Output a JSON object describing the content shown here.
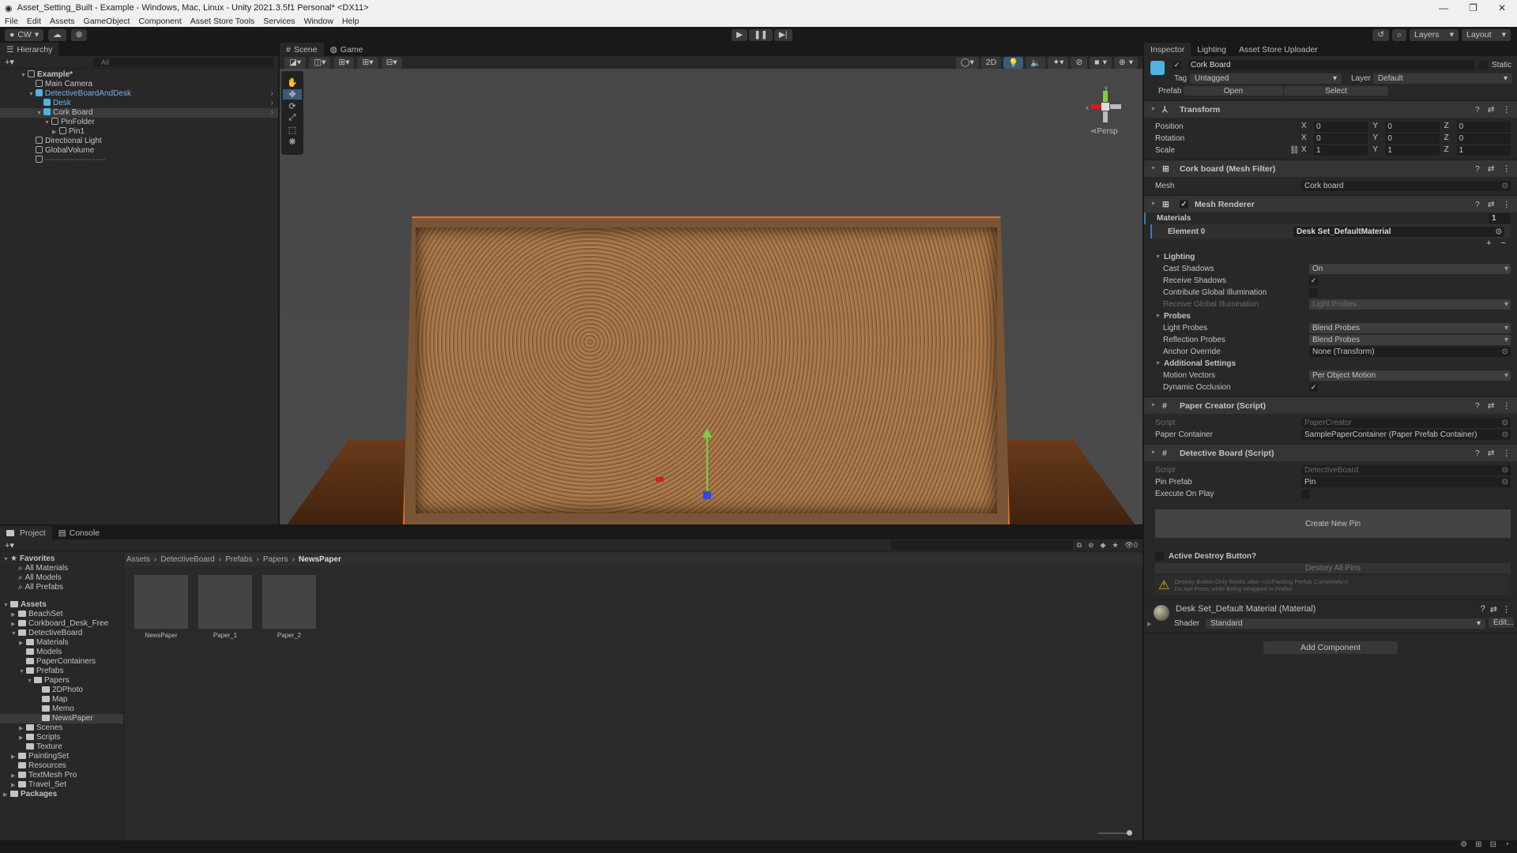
{
  "window": {
    "title": "Asset_Setting_Built - Example - Windows, Mac, Linux - Unity 2021.3.5f1 Personal* <DX11>",
    "controls": [
      "—",
      "❐",
      "✕"
    ]
  },
  "menu": [
    "File",
    "Edit",
    "Assets",
    "GameObject",
    "Component",
    "Asset Store Tools",
    "Services",
    "Window",
    "Help"
  ],
  "toolbar": {
    "account": "CW",
    "layers": "Layers",
    "layout": "Layout"
  },
  "hierarchy": {
    "tab": "Hierarchy",
    "search_placeholder": "All",
    "items": [
      {
        "label": "Example*",
        "depth": 0,
        "type": "scene",
        "expanded": true
      },
      {
        "label": "Main Camera",
        "depth": 1,
        "type": "obj"
      },
      {
        "label": "DetectiveBoardAndDesk",
        "depth": 1,
        "type": "prefab",
        "expanded": true,
        "blue": true
      },
      {
        "label": "Desk",
        "depth": 2,
        "type": "prefab",
        "blue": true
      },
      {
        "label": "Cork Board",
        "depth": 2,
        "type": "prefab",
        "expanded": true,
        "selected": true
      },
      {
        "label": "PinFolder",
        "depth": 3,
        "type": "obj",
        "expanded": true
      },
      {
        "label": "Pin1",
        "depth": 4,
        "type": "obj",
        "collapsed": true
      },
      {
        "label": "Directional Light",
        "depth": 1,
        "type": "obj"
      },
      {
        "label": "GlobalVolume",
        "depth": 1,
        "type": "obj"
      },
      {
        "label": "-----------------------",
        "depth": 1,
        "type": "obj",
        "dim": true
      }
    ]
  },
  "scene": {
    "tabs": [
      "Scene",
      "Game"
    ],
    "mode_2d": "2D",
    "persp": "Persp",
    "gizmo_axes": [
      "x",
      "y"
    ]
  },
  "inspector": {
    "tabs": [
      "Inspector",
      "Lighting",
      "Asset Store Uploader"
    ],
    "object": {
      "name": "Cork Board",
      "active": true,
      "static_label": "Static",
      "tag_label": "Tag",
      "tag": "Untagged",
      "layer_label": "Layer",
      "layer": "Default",
      "prefab_label": "Prefab",
      "open": "Open",
      "select": "Select"
    },
    "transform": {
      "title": "Transform",
      "rows": [
        {
          "label": "Position",
          "x": "0",
          "y": "0",
          "z": "0"
        },
        {
          "label": "Rotation",
          "x": "0",
          "y": "0",
          "z": "0"
        },
        {
          "label": "Scale",
          "x": "1",
          "y": "1",
          "z": "1"
        }
      ]
    },
    "mesh_filter": {
      "title": "Cork board (Mesh Filter)",
      "mesh_label": "Mesh",
      "mesh": "Cork board"
    },
    "mesh_renderer": {
      "title": "Mesh Renderer",
      "materials_label": "Materials",
      "materials_count": "1",
      "element_label": "Element 0",
      "element": "Desk Set_DefaultMaterial",
      "lighting": {
        "title": "Lighting",
        "rows": [
          {
            "label": "Cast Shadows",
            "value": "On",
            "kind": "dd"
          },
          {
            "label": "Receive Shadows",
            "value": "✓",
            "kind": "chk"
          },
          {
            "label": "Contribute Global Illumination",
            "value": "",
            "kind": "chk"
          },
          {
            "label": "Receive Global Illumination",
            "value": "Light Probes",
            "kind": "dd",
            "dim": true
          }
        ]
      },
      "probes": {
        "title": "Probes",
        "rows": [
          {
            "label": "Light Probes",
            "value": "Blend Probes",
            "kind": "dd"
          },
          {
            "label": "Reflection Probes",
            "value": "Blend Probes",
            "kind": "dd"
          },
          {
            "label": "Anchor Override",
            "value": "None (Transform)",
            "kind": "obj"
          }
        ]
      },
      "additional": {
        "title": "Additional Settings",
        "rows": [
          {
            "label": "Motion Vectors",
            "value": "Per Object Motion",
            "kind": "dd"
          },
          {
            "label": "Dynamic Occlusion",
            "value": "✓",
            "kind": "chk"
          }
        ]
      }
    },
    "paper_creator": {
      "title": "Paper Creator (Script)",
      "rows": [
        {
          "label": "Script",
          "value": "PaperCreator",
          "kind": "obj",
          "dim": true
        },
        {
          "label": "Paper Container",
          "value": "SamplePaperContainer (Paper Prefab Container)",
          "kind": "obj"
        }
      ]
    },
    "detective_board": {
      "title": "Detective Board (Script)",
      "rows": [
        {
          "label": "Script",
          "value": "DetectiveBoard",
          "kind": "obj",
          "dim": true
        },
        {
          "label": "Pin Prefab",
          "value": "Pin",
          "kind": "obj"
        },
        {
          "label": "Execute On Play",
          "value": "",
          "kind": "chk"
        }
      ],
      "create_button": "Create New Pin",
      "active_destroy": "Active Destroy Button?",
      "destroy_button": "Destory All Pins",
      "warning": [
        "Destroy Button Only Works after <UnPacking Prefab Completely>!",
        "Do Not Press while Being Wrapped in Prefab"
      ]
    },
    "material": {
      "title": "Desk Set_Default Material (Material)",
      "shader_label": "Shader",
      "shader": "Standard",
      "edit": "Edit..."
    },
    "add_component": "Add Component"
  },
  "project": {
    "tabs": [
      "Project",
      "Console"
    ],
    "breadcrumb": [
      "Assets",
      "DetectiveBoard",
      "Prefabs",
      "Papers",
      "NewsPaper"
    ],
    "tree": [
      {
        "label": "Favorites",
        "depth": 0,
        "kind": "star",
        "bold": true
      },
      {
        "label": "All Materials",
        "depth": 1,
        "kind": "search"
      },
      {
        "label": "All Models",
        "depth": 1,
        "kind": "search"
      },
      {
        "label": "All Prefabs",
        "depth": 1,
        "kind": "search"
      },
      {
        "label": "",
        "depth": 0,
        "kind": "gap"
      },
      {
        "label": "Assets",
        "depth": 0,
        "kind": "folder",
        "bold": true,
        "exp": "▼"
      },
      {
        "label": "BeachSet",
        "depth": 1,
        "kind": "folder",
        "exp": "▶"
      },
      {
        "label": "Corkboard_Desk_Free",
        "depth": 1,
        "kind": "folder",
        "exp": "▶"
      },
      {
        "label": "DetectiveBoard",
        "depth": 1,
        "kind": "folder",
        "exp": "▼"
      },
      {
        "label": "Materials",
        "depth": 2,
        "kind": "folder",
        "exp": "▶"
      },
      {
        "label": "Models",
        "depth": 2,
        "kind": "folder"
      },
      {
        "label": "PaperContainers",
        "depth": 2,
        "kind": "folder"
      },
      {
        "label": "Prefabs",
        "depth": 2,
        "kind": "folder",
        "exp": "▼"
      },
      {
        "label": "Papers",
        "depth": 3,
        "kind": "folder",
        "exp": "▼"
      },
      {
        "label": "2DPhoto",
        "depth": 4,
        "kind": "folder"
      },
      {
        "label": "Map",
        "depth": 4,
        "kind": "folder"
      },
      {
        "label": "Memo",
        "depth": 4,
        "kind": "folder"
      },
      {
        "label": "NewsPaper",
        "depth": 4,
        "kind": "folder",
        "selected": true
      },
      {
        "label": "Scenes",
        "depth": 2,
        "kind": "folder",
        "exp": "▶"
      },
      {
        "label": "Scripts",
        "depth": 2,
        "kind": "folder",
        "exp": "▶"
      },
      {
        "label": "Texture",
        "depth": 2,
        "kind": "folder"
      },
      {
        "label": "PaintingSet",
        "depth": 1,
        "kind": "folder",
        "exp": "▶"
      },
      {
        "label": "Resources",
        "depth": 1,
        "kind": "folder"
      },
      {
        "label": "TextMesh Pro",
        "depth": 1,
        "kind": "folder",
        "exp": "▶"
      },
      {
        "label": "Travel_Set",
        "depth": 1,
        "kind": "folder",
        "exp": "▶"
      },
      {
        "label": "Packages",
        "depth": 0,
        "kind": "folder",
        "bold": true,
        "exp": "▶"
      }
    ],
    "assets": [
      "NewsPaper",
      "Paper_1",
      "Paper_2"
    ],
    "hidden_count": "0"
  },
  "colors": {
    "selection": "#2c5d87",
    "panel": "#282828",
    "accent_blue": "#7ab0ea",
    "outline": "#f26c1f"
  }
}
